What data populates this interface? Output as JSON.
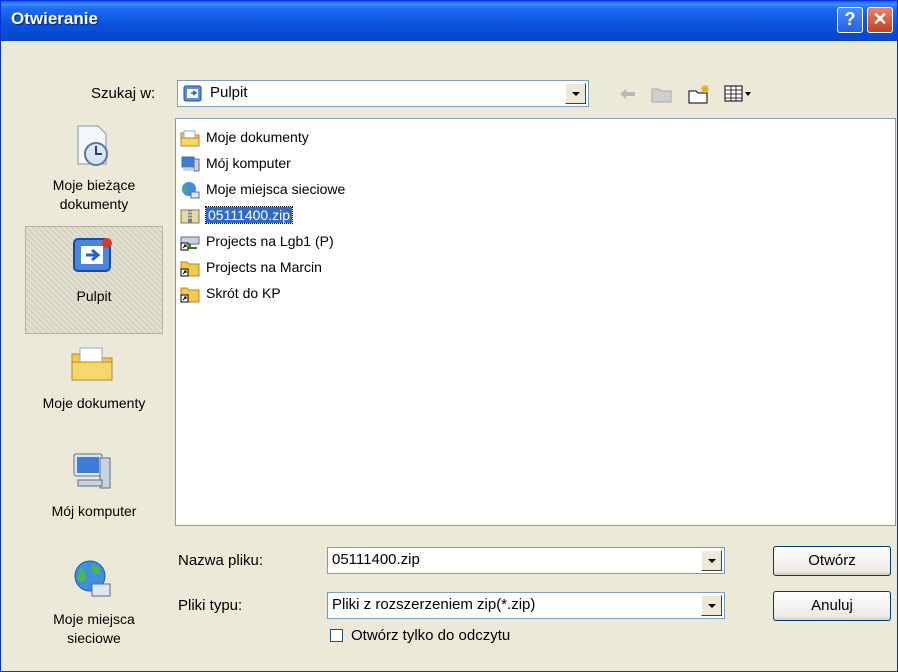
{
  "window": {
    "title": "Otwieranie",
    "help_glyph": "?",
    "close_glyph": "✕"
  },
  "lookin": {
    "label": "Szukaj w:",
    "value": "Pulpit"
  },
  "toolbar": {
    "icons": [
      "back-arrow-icon",
      "up-folder-icon",
      "new-folder-icon",
      "view-menu-icon"
    ]
  },
  "places": [
    {
      "label": "Moje bieżące dokumenty",
      "icon": "recent-documents-icon"
    },
    {
      "label": "Pulpit",
      "icon": "desktop-icon"
    },
    {
      "label": "Moje dokumenty",
      "icon": "my-documents-icon"
    },
    {
      "label": "Mój komputer",
      "icon": "my-computer-icon"
    },
    {
      "label": "Moje miejsca sieciowe",
      "icon": "network-places-icon"
    }
  ],
  "files": [
    {
      "name": "Moje dokumenty",
      "icon": "my-documents-icon"
    },
    {
      "name": "Mój komputer",
      "icon": "my-computer-icon"
    },
    {
      "name": "Moje miejsca sieciowe",
      "icon": "network-places-icon"
    },
    {
      "name": "05111400.zip",
      "icon": "zip-file-icon",
      "selected": true
    },
    {
      "name": "Projects na Lgb1 (P)",
      "icon": "network-drive-icon"
    },
    {
      "name": "Projects na Marcin",
      "icon": "folder-shortcut-icon"
    },
    {
      "name": "Skrót do KP",
      "icon": "folder-shortcut-icon"
    }
  ],
  "filename": {
    "label": "Nazwa pliku:",
    "value": "05111400.zip"
  },
  "filetype": {
    "label": "Pliki typu:",
    "value": "Pliki z rozszerzeniem zip(*.zip)"
  },
  "readonly": {
    "label": "Otwórz tylko do odczytu",
    "checked": false
  },
  "buttons": {
    "open": "Otwórz",
    "cancel": "Anuluj"
  }
}
